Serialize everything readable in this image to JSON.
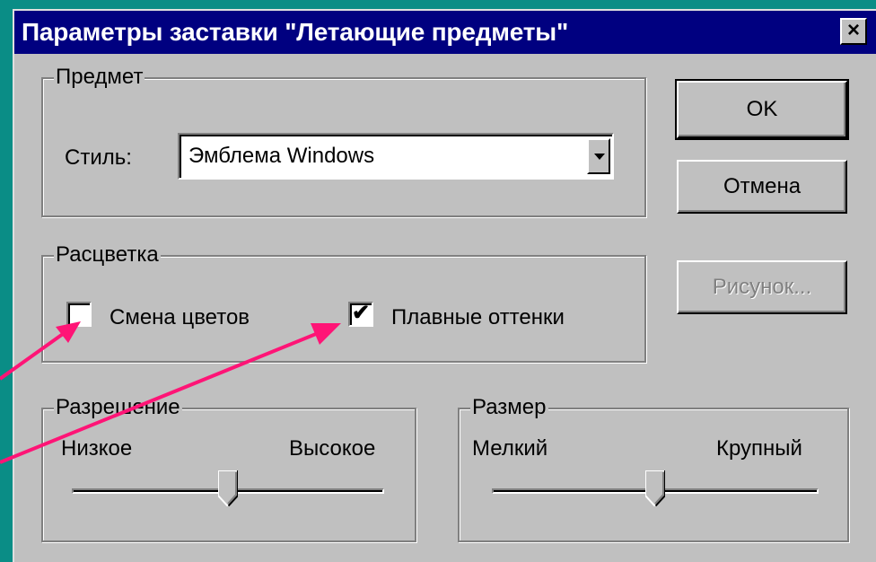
{
  "window": {
    "title": "Параметры заставки \"Летающие предметы\"",
    "close_glyph": "×"
  },
  "object_group": {
    "label": "Предмет",
    "style_label": "Стиль:",
    "style_value": "Эмблема Windows"
  },
  "color_group": {
    "label": "Расцветка",
    "cycle_colors": {
      "label": "Смена цветов",
      "checked": false
    },
    "smooth_shades": {
      "label": "Плавные оттенки",
      "checked": true,
      "mark": "✔"
    }
  },
  "resolution_group": {
    "label": "Разрешение",
    "min_label": "Низкое",
    "max_label": "Высокое",
    "level": 0.5
  },
  "size_group": {
    "label": "Размер",
    "min_label": "Мелкий",
    "max_label": "Крупный",
    "level": 0.5
  },
  "buttons": {
    "ok": "OK",
    "cancel": "Отмена",
    "picture": "Рисунок..."
  },
  "colors": {
    "desktop": "#0a8d86",
    "face": "#c0c0c0",
    "titlebar": "#000080",
    "annotation_arrow": "#ff1476"
  }
}
